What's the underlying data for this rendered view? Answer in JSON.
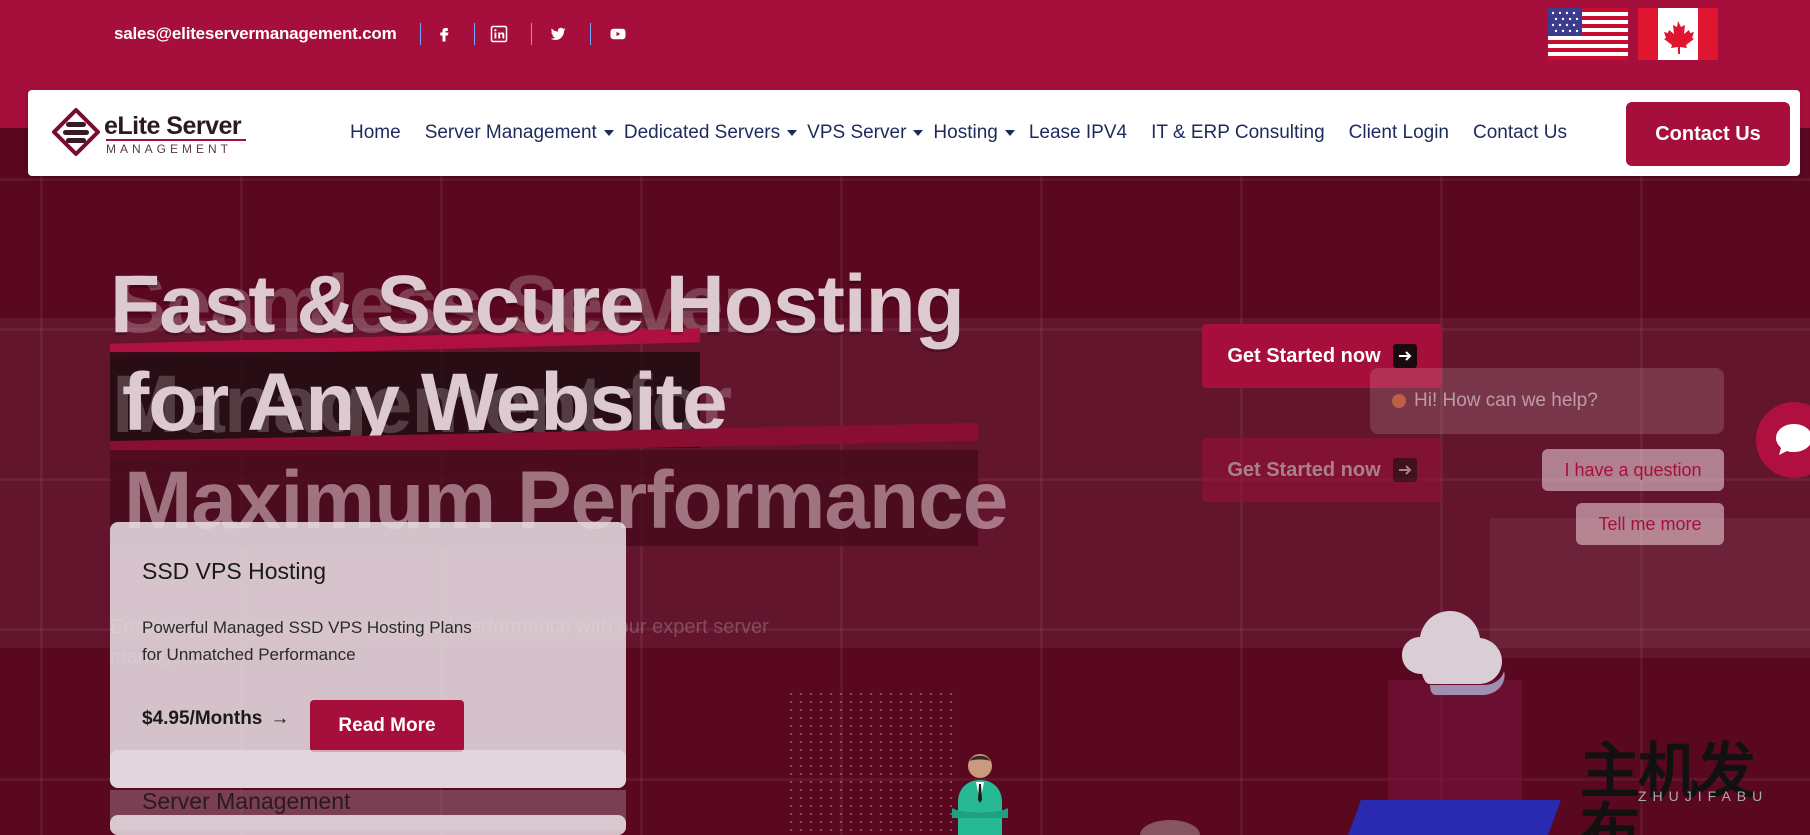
{
  "topbar": {
    "email": "sales@eliteservermanagement.com",
    "social": [
      "facebook-icon",
      "linkedin-icon",
      "twitter-icon",
      "youtube-icon"
    ],
    "flags": [
      "us-flag-icon",
      "canada-flag-icon"
    ]
  },
  "nav": {
    "brand": "eLite Server",
    "brand_sub": "MANAGEMENT",
    "items": [
      {
        "label": "Home",
        "dropdown": false
      },
      {
        "label": "Server Management",
        "dropdown": true
      },
      {
        "label": "Dedicated Servers",
        "dropdown": true
      },
      {
        "label": "VPS Server",
        "dropdown": true
      },
      {
        "label": "Hosting",
        "dropdown": true
      },
      {
        "label": "Lease IPV4",
        "dropdown": false
      },
      {
        "label": "IT & ERP Consulting",
        "dropdown": false
      },
      {
        "label": "Client Login",
        "dropdown": false
      },
      {
        "label": "Contact Us",
        "dropdown": false
      }
    ],
    "cta": "Contact Us"
  },
  "hero": {
    "headline_1": "Fast & Secure Hosting",
    "headline_2": "for Any Website",
    "headline_3": "Maximum Performance",
    "ghost_1": "Seamless Server",
    "ghost_2": "Management for",
    "subtitle": "Ensure uptime, security, and optimized performance with our expert server management.",
    "get_started": "Get Started now"
  },
  "card": {
    "title": "SSD VPS Hosting",
    "description": "Powerful Managed SSD VPS Hosting Plans for Unmatched Performance",
    "price": "$4.95/Months",
    "read_more": "Read More",
    "next_title": "Server Management"
  },
  "chat": {
    "greeting": "Hi! How can we help?",
    "option_1": "I have a question",
    "option_2": "Tell me more"
  },
  "watermark": {
    "cn": "主机发布",
    "pinyin": "ZHUJIFABU"
  },
  "colors": {
    "brand": "#a60f3b",
    "nav_text": "#1d2a5c"
  }
}
